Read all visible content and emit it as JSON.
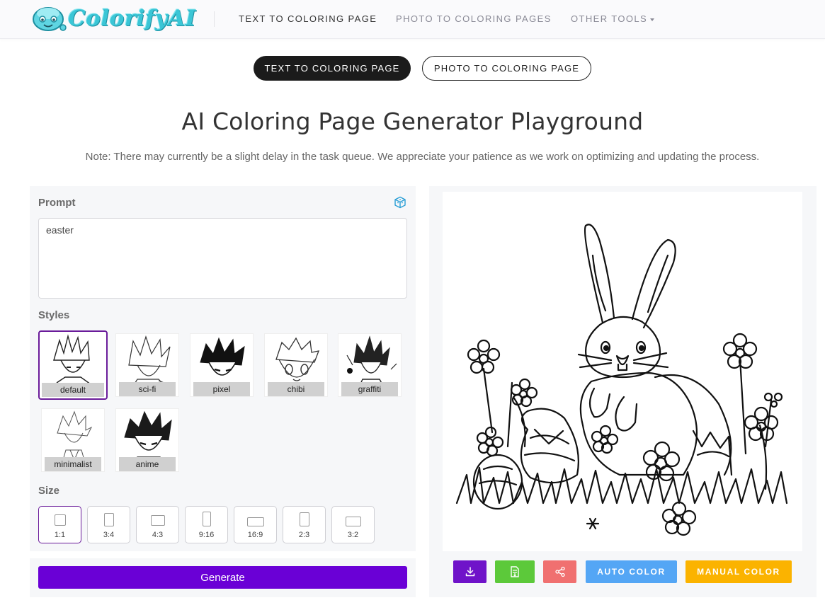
{
  "brand": {
    "name": "ColorifyAI"
  },
  "nav": {
    "items": [
      {
        "label": "TEXT TO COLORING PAGE"
      },
      {
        "label": "PHOTO TO COLORING PAGES"
      },
      {
        "label": "OTHER TOOLS"
      }
    ]
  },
  "mode_toggle": {
    "text_label": "TEXT TO COLORING PAGE",
    "photo_label": "PHOTO TO COLORING PAGE"
  },
  "page": {
    "title": "AI Coloring Page Generator Playground",
    "note": "Note: There may currently be a slight delay in the task queue. We appreciate your patience as we work on optimizing and updating the process."
  },
  "prompt": {
    "label": "Prompt",
    "value": "easter"
  },
  "styles": {
    "label": "Styles",
    "selected": "default",
    "items": [
      {
        "label": "default"
      },
      {
        "label": "sci-fi"
      },
      {
        "label": "pixel"
      },
      {
        "label": "chibi"
      },
      {
        "label": "graffiti"
      },
      {
        "label": "minimalist"
      },
      {
        "label": "anime"
      }
    ]
  },
  "size": {
    "label": "Size",
    "selected": "1:1",
    "items": [
      {
        "label": "1:1"
      },
      {
        "label": "3:4"
      },
      {
        "label": "4:3"
      },
      {
        "label": "9:16"
      },
      {
        "label": "16:9"
      },
      {
        "label": "2:3"
      },
      {
        "label": "3:2"
      }
    ]
  },
  "generate": {
    "label": "Generate"
  },
  "actions": {
    "download_icon": "download-icon",
    "pdf_icon": "file-pdf-icon",
    "share_icon": "share-icon",
    "auto_color_label": "AUTO COLOR",
    "manual_color_label": "MANUAL COLOR"
  },
  "colors": {
    "accent": "#6a00d6",
    "selected_border": "#6a1b9a",
    "download_btn": "#6f13c9",
    "pdf_btn": "#5cc93a",
    "share_btn": "#f07070",
    "auto_color_btn": "#54a6f5",
    "manual_color_btn": "#fbb300",
    "logo": "#3bc6d6"
  }
}
